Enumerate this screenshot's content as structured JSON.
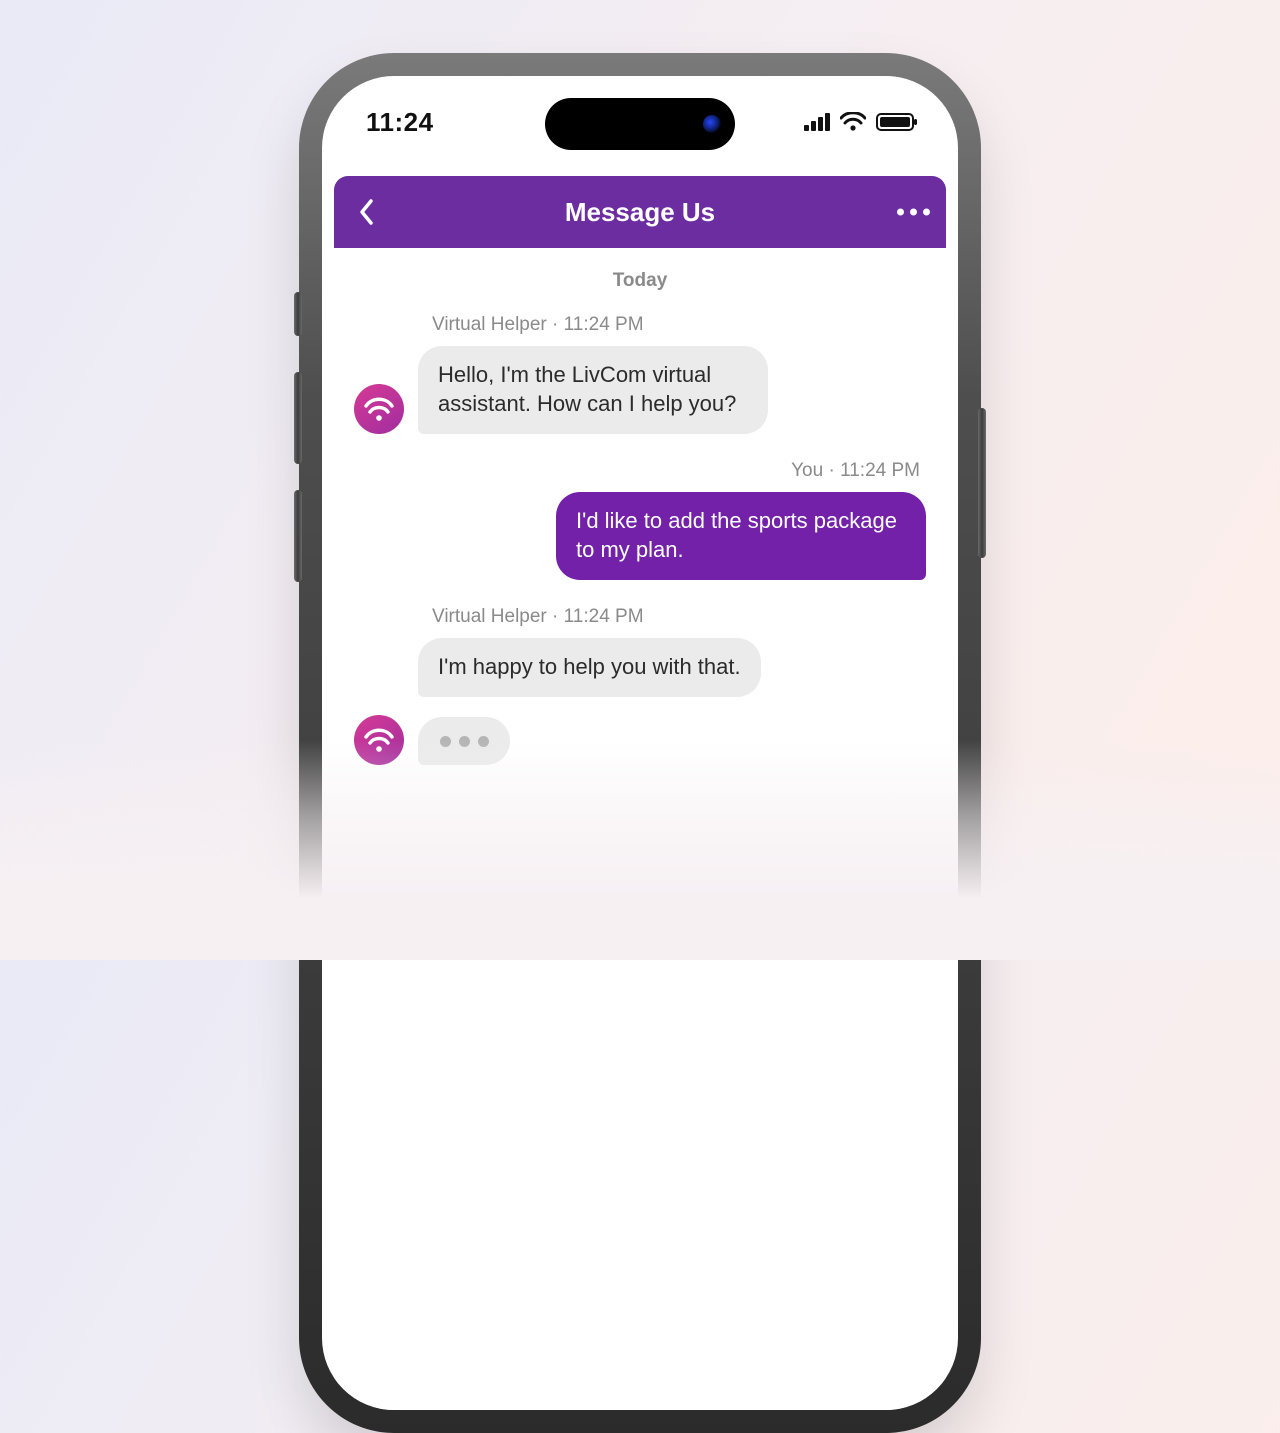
{
  "status": {
    "time": "11:24"
  },
  "header": {
    "title": "Message Us"
  },
  "chat": {
    "date_separator": "Today",
    "messages": [
      {
        "side": "left",
        "meta": "Virtual Helper · 11:24 PM",
        "text": "Hello, I'm the LivCom virtual assistant. How can I help you?"
      },
      {
        "side": "right",
        "meta": "You · 11:24 PM",
        "text": "I'd like to add the sports package to my plan."
      },
      {
        "side": "left",
        "meta": "Virtual Helper · 11:24 PM",
        "text": "I'm happy to help you with that."
      }
    ]
  }
}
